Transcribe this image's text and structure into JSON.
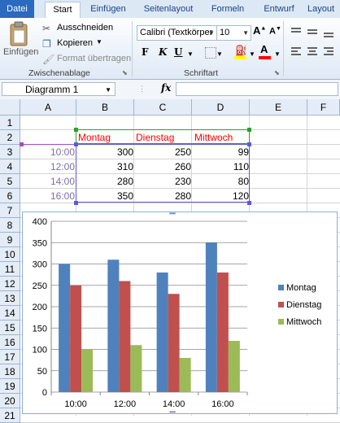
{
  "ribbon": {
    "tabs": [
      {
        "label": "Datei",
        "name": "tab-datei"
      },
      {
        "label": "Start",
        "name": "tab-start"
      },
      {
        "label": "Einfügen",
        "name": "tab-einfuegen"
      },
      {
        "label": "Seitenlayout",
        "name": "tab-seitenlayout"
      },
      {
        "label": "Formeln",
        "name": "tab-formeln"
      },
      {
        "label": "Entwurf",
        "name": "tab-entwurf"
      },
      {
        "label": "Layout",
        "name": "tab-layout"
      }
    ],
    "clipboard": {
      "paste_label": "Einfügen",
      "cut_label": "Ausschneiden",
      "copy_label": "Kopieren",
      "format_painter_label": "Format übertragen",
      "group_label": "Zwischenablage"
    },
    "font": {
      "font_name": "Calibri (Textkörper",
      "font_size": "10",
      "grow_label": "A",
      "shrink_label": "A",
      "bold_label": "F",
      "italic_label": "K",
      "underline_label": "U",
      "font_color": "A",
      "group_label": "Schriftart",
      "highlight_color": "#ffff00",
      "font_color_value": "#ff0000"
    }
  },
  "formula_bar": {
    "name_box": "Diagramm 1",
    "fx_label": "fx",
    "formula": ""
  },
  "sheet": {
    "columns": [
      "A",
      "B",
      "C",
      "D",
      "E",
      "F"
    ],
    "rows": [
      "1",
      "2",
      "3",
      "4",
      "5",
      "6",
      "7",
      "8",
      "9",
      "10",
      "11",
      "12",
      "13",
      "14",
      "15",
      "16",
      "17",
      "18",
      "19",
      "20",
      "21"
    ],
    "headers": [
      "Montag",
      "Dienstag",
      "Mittwoch"
    ],
    "times": [
      "10:00",
      "12:00",
      "14:00",
      "16:00"
    ],
    "values": [
      [
        "300",
        "250",
        "99"
      ],
      [
        "310",
        "260",
        "110"
      ],
      [
        "280",
        "230",
        "80"
      ],
      [
        "350",
        "280",
        "120"
      ]
    ]
  },
  "chart_data": {
    "type": "bar",
    "categories": [
      "10:00",
      "12:00",
      "14:00",
      "16:00"
    ],
    "series": [
      {
        "name": "Montag",
        "values": [
          300,
          310,
          280,
          350
        ],
        "color": "#4f81bd"
      },
      {
        "name": "Dienstag",
        "values": [
          250,
          260,
          230,
          280
        ],
        "color": "#c0504d"
      },
      {
        "name": "Mittwoch",
        "values": [
          100,
          110,
          80,
          120
        ],
        "color": "#9bbb59"
      }
    ],
    "ylim": [
      0,
      400
    ],
    "yticks": [
      "0",
      "50",
      "100",
      "150",
      "200",
      "250",
      "300",
      "350",
      "400"
    ],
    "grid": true,
    "legend": "right"
  }
}
